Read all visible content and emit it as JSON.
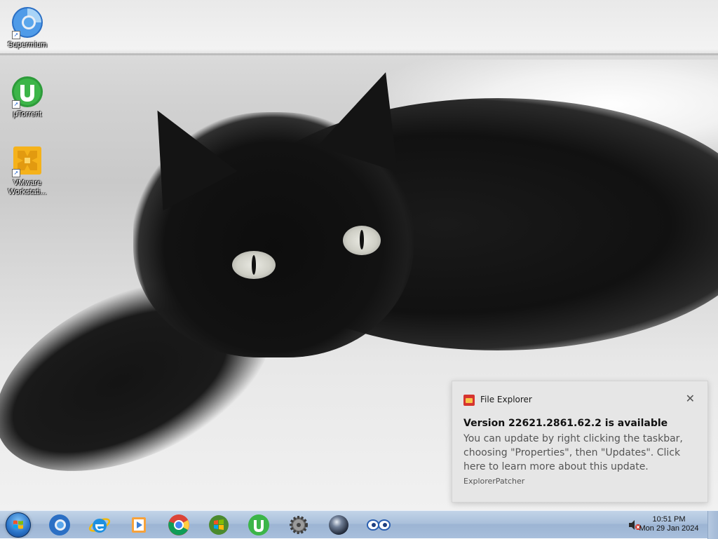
{
  "desktop": {
    "icons": [
      {
        "label": "Supermium",
        "icon": "supermium-icon"
      },
      {
        "label": "μTorrent",
        "icon": "utorrent-icon"
      },
      {
        "label": "VMware Workstati...",
        "icon": "vmware-icon"
      }
    ]
  },
  "toast": {
    "app_name": "File Explorer",
    "close_glyph": "✕",
    "title": "Version 22621.2861.62.2 is available",
    "body": "You can update by right clicking the taskbar, choosing \"Properties\", then \"Updates\". Click here to learn more about this update.",
    "source": "ExplorerPatcher"
  },
  "taskbar": {
    "start": "start-orb",
    "pinned": [
      "supermium-icon",
      "internet-explorer-icon",
      "windows-media-player-icon",
      "chrome-icon",
      "windows-update-icon",
      "utorrent-icon",
      "settings-gear-icon",
      "marble-orb-icon",
      "eyes-icon"
    ],
    "tray": {
      "volume_icon": "volume-muted-icon",
      "time": "10:51 PM",
      "date": "Mon 29 Jan 2024"
    }
  },
  "colors": {
    "toast_bg": "#e6e6e6",
    "taskbar_top": "#c2d4e8",
    "taskbar_bottom": "#a8bfdc"
  }
}
